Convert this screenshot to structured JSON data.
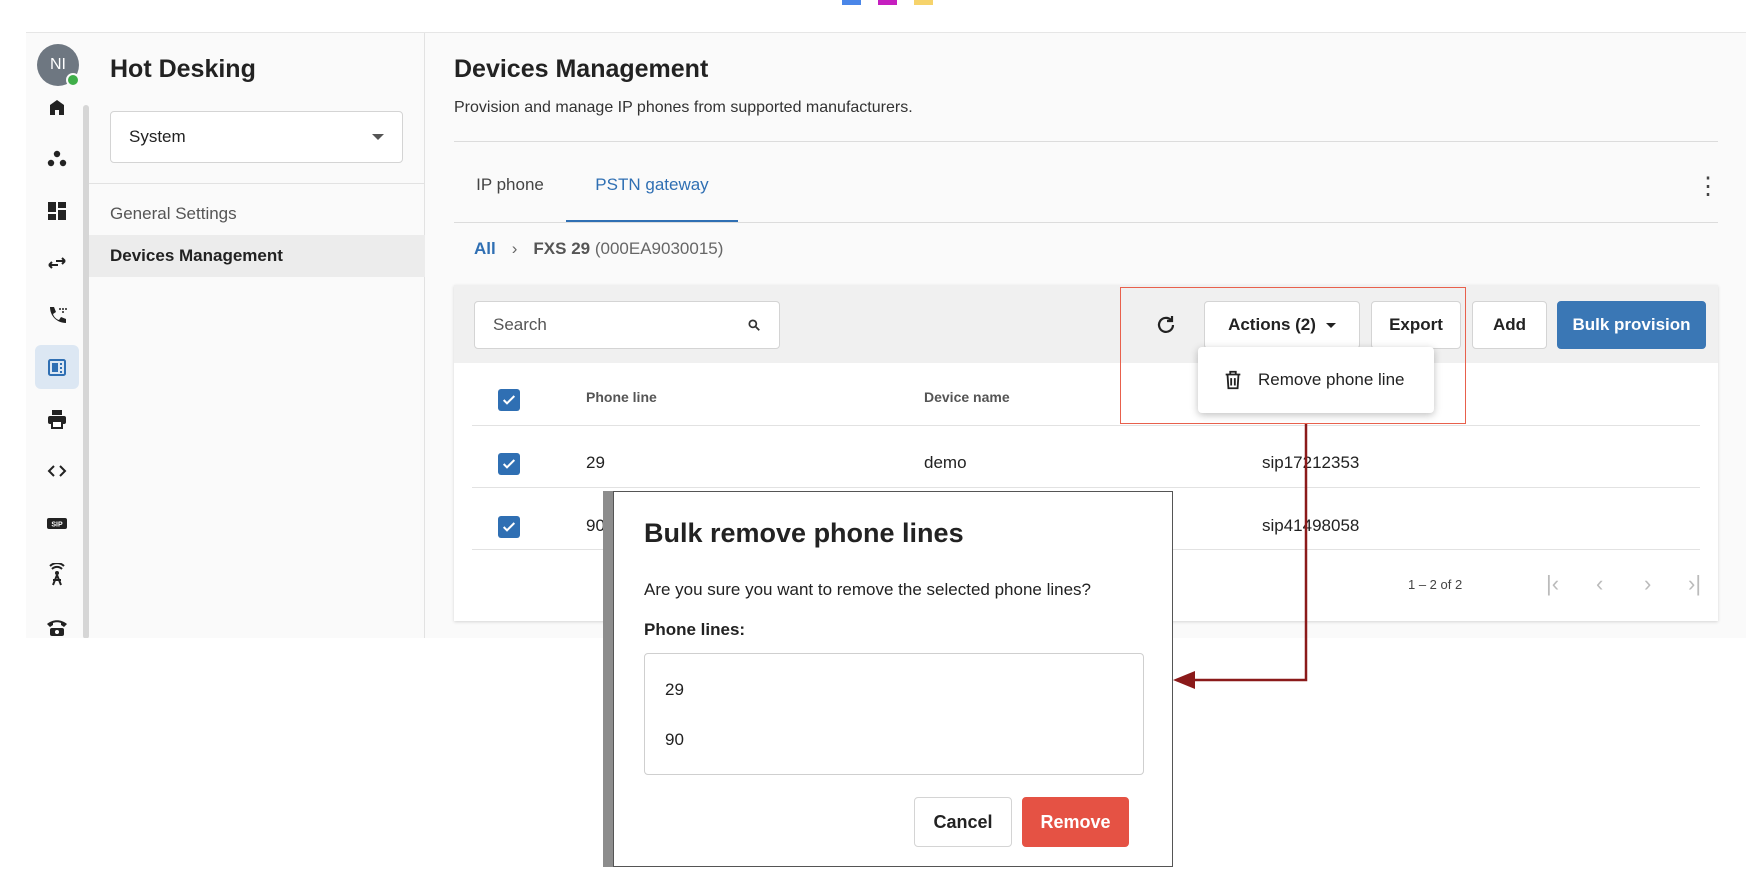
{
  "colors": {
    "accent": "#2f6fb3",
    "primary_button": "#3a77b5",
    "danger": "#e55244",
    "annotation": "#e8604c",
    "arrow": "#8b1a1a",
    "online": "#3fae49"
  },
  "top_marks": [
    "#4a86e8",
    "#c51fbf",
    "#f6d36b"
  ],
  "rail": {
    "avatar_initials": "NI",
    "items": [
      {
        "icon": "home-icon"
      },
      {
        "icon": "users-group-icon"
      },
      {
        "icon": "dashboard-icon"
      },
      {
        "icon": "transfer-arrows-icon"
      },
      {
        "icon": "phone-dialpad-icon"
      },
      {
        "icon": "desk-phone-icon",
        "active": true
      },
      {
        "icon": "printer-icon"
      },
      {
        "icon": "code-icon"
      },
      {
        "icon": "sip-icon",
        "label": "SIP"
      },
      {
        "icon": "antenna-icon"
      },
      {
        "icon": "telephone-icon"
      }
    ]
  },
  "sidebar": {
    "title": "Hot Desking",
    "select_value": "System",
    "items": [
      {
        "label": "General Settings"
      },
      {
        "label": "Devices Management",
        "active": true
      }
    ]
  },
  "main": {
    "title": "Devices Management",
    "subtitle": "Provision and manage IP phones from supported manufacturers.",
    "tabs": [
      {
        "label": "IP phone"
      },
      {
        "label": "PSTN gateway",
        "active": true
      }
    ],
    "breadcrumb": {
      "root": "All",
      "current": "FXS 29",
      "current_extra": "(000EA9030015)"
    },
    "toolbar": {
      "search_placeholder": "Search",
      "actions_label": "Actions (2)",
      "export_label": "Export",
      "add_label": "Add",
      "bulk_label": "Bulk provision"
    },
    "table": {
      "columns": [
        "Phone line",
        "Device name"
      ],
      "rows": [
        {
          "phone_line": "29",
          "device_name": "demo",
          "sip": "sip17212353",
          "checked": true
        },
        {
          "phone_line": "90",
          "device_name": "",
          "sip": "sip41498058",
          "checked": true
        }
      ],
      "pagination": "1 – 2 of 2"
    },
    "actions_menu": {
      "item": "Remove phone line"
    }
  },
  "dialog": {
    "title": "Bulk remove phone lines",
    "message": "Are you sure you want to remove the selected phone lines?",
    "list_label": "Phone lines:",
    "lines": [
      "29",
      "90"
    ],
    "cancel_label": "Cancel",
    "remove_label": "Remove"
  }
}
